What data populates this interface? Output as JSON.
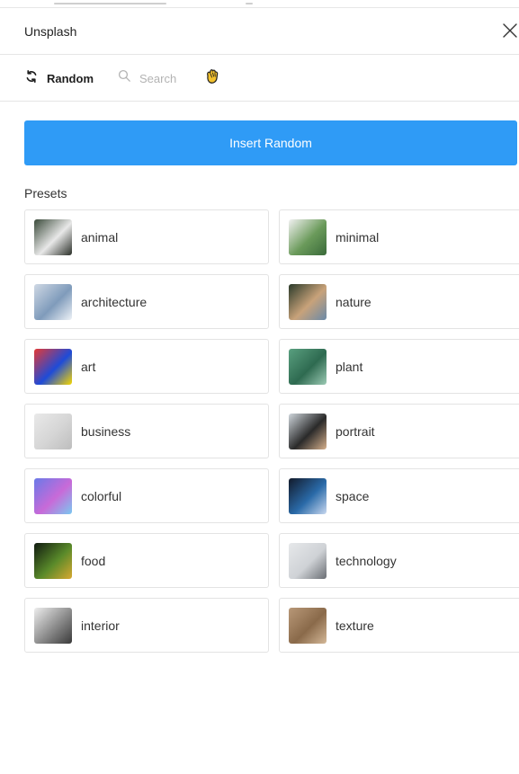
{
  "window": {
    "title": "Unsplash"
  },
  "toolbar": {
    "random_label": "Random",
    "search_label": "Search"
  },
  "actions": {
    "insert_random": "Insert Random"
  },
  "presets": {
    "heading": "Presets",
    "items": [
      {
        "label": "animal",
        "thumb": [
          "#3a4a3a",
          "#e8e8e8",
          "#2a2f28"
        ]
      },
      {
        "label": "minimal",
        "thumb": [
          "#f2f2f2",
          "#6a9a5a",
          "#3a6a3a"
        ]
      },
      {
        "label": "architecture",
        "thumb": [
          "#cfd8e4",
          "#7f9bbb",
          "#eef2f7"
        ]
      },
      {
        "label": "nature",
        "thumb": [
          "#2a3a2a",
          "#c8a27a",
          "#6a8aa8"
        ]
      },
      {
        "label": "art",
        "thumb": [
          "#e53935",
          "#1e4bd8",
          "#f6d800"
        ]
      },
      {
        "label": "plant",
        "thumb": [
          "#5aa080",
          "#2e6a50",
          "#9ccab4"
        ]
      },
      {
        "label": "business",
        "thumb": [
          "#e9e9e9",
          "#d5d5d5",
          "#bdbdbd"
        ]
      },
      {
        "label": "portrait",
        "thumb": [
          "#cfd6dc",
          "#2a2a2a",
          "#d6b08c"
        ]
      },
      {
        "label": "colorful",
        "thumb": [
          "#6a7ae8",
          "#c86ad8",
          "#7ac8f0"
        ]
      },
      {
        "label": "space",
        "thumb": [
          "#121a2a",
          "#2a6aa8",
          "#c8d8f0"
        ]
      },
      {
        "label": "food",
        "thumb": [
          "#101a10",
          "#5a8a2a",
          "#d8a830"
        ]
      },
      {
        "label": "technology",
        "thumb": [
          "#e6e8ea",
          "#cfd2d6",
          "#6a6e74"
        ]
      },
      {
        "label": "interior",
        "thumb": [
          "#eeeeee",
          "#8a8a8a",
          "#3a3a3a"
        ]
      },
      {
        "label": "texture",
        "thumb": [
          "#b89878",
          "#8a6a4a",
          "#d4b898"
        ]
      }
    ]
  }
}
